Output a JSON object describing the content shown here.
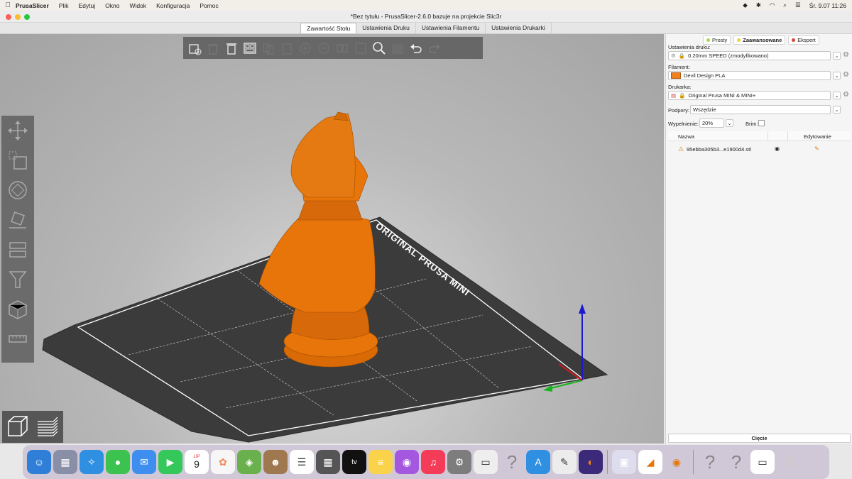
{
  "menubar": {
    "app": "PrusaSlicer",
    "items": [
      "Plik",
      "Edytuj",
      "Okno",
      "Widok",
      "Konfiguracja",
      "Pomoc"
    ],
    "datetime": "Śr. 9.07  11:26"
  },
  "window": {
    "title": "*Bez tytułu - PrusaSlicer-2.6.0 bazuje na projekcie Slic3r"
  },
  "tabs": [
    "Zawartość Stołu",
    "Ustawienia Druku",
    "Ustawienia Filamentu",
    "Ustawienia Drukarki"
  ],
  "active_tab": "Zawartość Stołu",
  "panel": {
    "modes": [
      {
        "label": "Prosty",
        "color": "#a8d94f"
      },
      {
        "label": "Zaawansowane",
        "color": "#f4d03f"
      },
      {
        "label": "Ekspert",
        "color": "#e0413a"
      }
    ],
    "print_label": "Ustawienia druku:",
    "print_value": "0.20mm SPEED (zmodyfikowano)",
    "filament_label": "Filament:",
    "filament_value": "Devil Design PLA",
    "filament_color": "#f28020",
    "printer_label": "Drukarka:",
    "printer_value": "Original Prusa MINI & MINI+",
    "supports_label": "Podpory:",
    "supports_value": "Wszędzie",
    "infill_label": "Wypełnienie:",
    "infill_value": "20%",
    "brim_label": "Brim:",
    "col_name": "Nazwa",
    "col_edit": "Edytowanie",
    "object_name": "95ebba305b3...e1900d4.stl",
    "slice_button": "Cięcie"
  },
  "bed": {
    "label": "ORIGINAL PRUSA MINI"
  },
  "colors": {
    "accent_orange": "#e8750a",
    "bed_dark": "#3b3b3b"
  },
  "dock": {
    "calendar_month": "LIP",
    "calendar_day": "9",
    "appletv_label": "tv"
  }
}
